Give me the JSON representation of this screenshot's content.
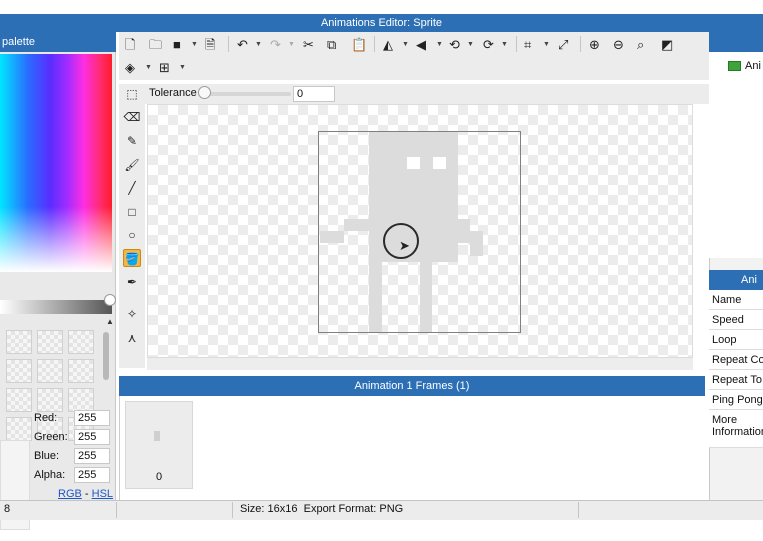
{
  "window": {
    "title": "Animations Editor: Sprite"
  },
  "palette": {
    "header": "palette",
    "color": {
      "red_label": "Red:",
      "red": "255",
      "green_label": "Green:",
      "green": "255",
      "blue_label": "Blue:",
      "blue": "255",
      "alpha_label": "Alpha:",
      "alpha": "255"
    },
    "modes": {
      "rgb": "RGB",
      "separator": " - ",
      "hsl": "HSL"
    }
  },
  "toolbar": {
    "icons": [
      "new-file-icon",
      "open-folder-icon",
      "save-icon",
      "export-icon",
      "undo-icon",
      "redo-icon",
      "cut-icon",
      "copy-icon",
      "paste-icon",
      "flip-horizontal-icon",
      "flip-vertical-icon",
      "rotate-left-icon",
      "rotate-right-icon",
      "crop-icon",
      "resize-icon",
      "zoom-in-icon",
      "zoom-out-icon",
      "zoom-fit-icon",
      "grid-toggle-icon",
      "layers-icon",
      "grid-icon"
    ],
    "tolerance_label": "Tolerance",
    "tolerance_value": "0",
    "tolerance_fraction": 0
  },
  "tools": [
    "select-tool",
    "eraser-tool",
    "pencil-tool",
    "brush-tool",
    "line-tool",
    "rectangle-tool",
    "ellipse-tool",
    "paint-bucket-tool",
    "eyedropper-tool",
    "star-tool",
    "node-tool"
  ],
  "frames": {
    "header": "Animation 1 Frames (1)",
    "items": [
      {
        "index_label": "0"
      }
    ]
  },
  "animations": {
    "item_label": "Ani",
    "props_header": "Ani",
    "properties": [
      "Name",
      "Speed",
      "Loop",
      "Repeat Co",
      "Repeat To",
      "Ping Pong",
      "More Information"
    ]
  },
  "status": {
    "left": "8",
    "size": "Size: 16x16",
    "export": "Export Format: PNG"
  }
}
